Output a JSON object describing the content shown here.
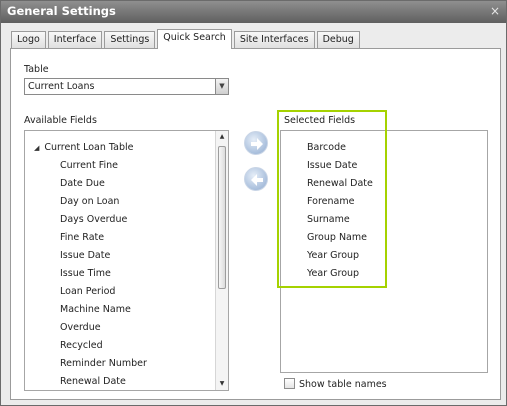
{
  "window": {
    "title": "General Settings",
    "close_glyph": "×"
  },
  "tabs": [
    {
      "label": "Logo",
      "active": false
    },
    {
      "label": "Interface",
      "active": false
    },
    {
      "label": "Settings",
      "active": false
    },
    {
      "label": "Quick Search",
      "active": true
    },
    {
      "label": "Site Interfaces",
      "active": false
    },
    {
      "label": "Debug",
      "active": false
    }
  ],
  "table": {
    "label": "Table",
    "selected": "Current Loans"
  },
  "available": {
    "label": "Available Fields",
    "group": "Current Loan Table",
    "items": [
      "Current Fine",
      "Date Due",
      "Day on Loan",
      "Days Overdue",
      "Fine Rate",
      "Issue Date",
      "Issue Time",
      "Loan Period",
      "Machine Name",
      "Overdue",
      "Recycled",
      "Reminder Number",
      "Renewal Date"
    ]
  },
  "selected": {
    "label": "Selected Fields",
    "items": [
      "Barcode",
      "Issue Date",
      "Renewal Date",
      "Forename",
      "Surname",
      "Group Name",
      "Year Group",
      "Year Group"
    ]
  },
  "buttons": {
    "add_icon": "arrow-right-icon",
    "remove_icon": "arrow-left-icon"
  },
  "options": {
    "show_table_names": "Show table names",
    "show_table_names_checked": false
  },
  "colors": {
    "highlight": "#a5d200",
    "title_bar": "#6f6f6f"
  }
}
